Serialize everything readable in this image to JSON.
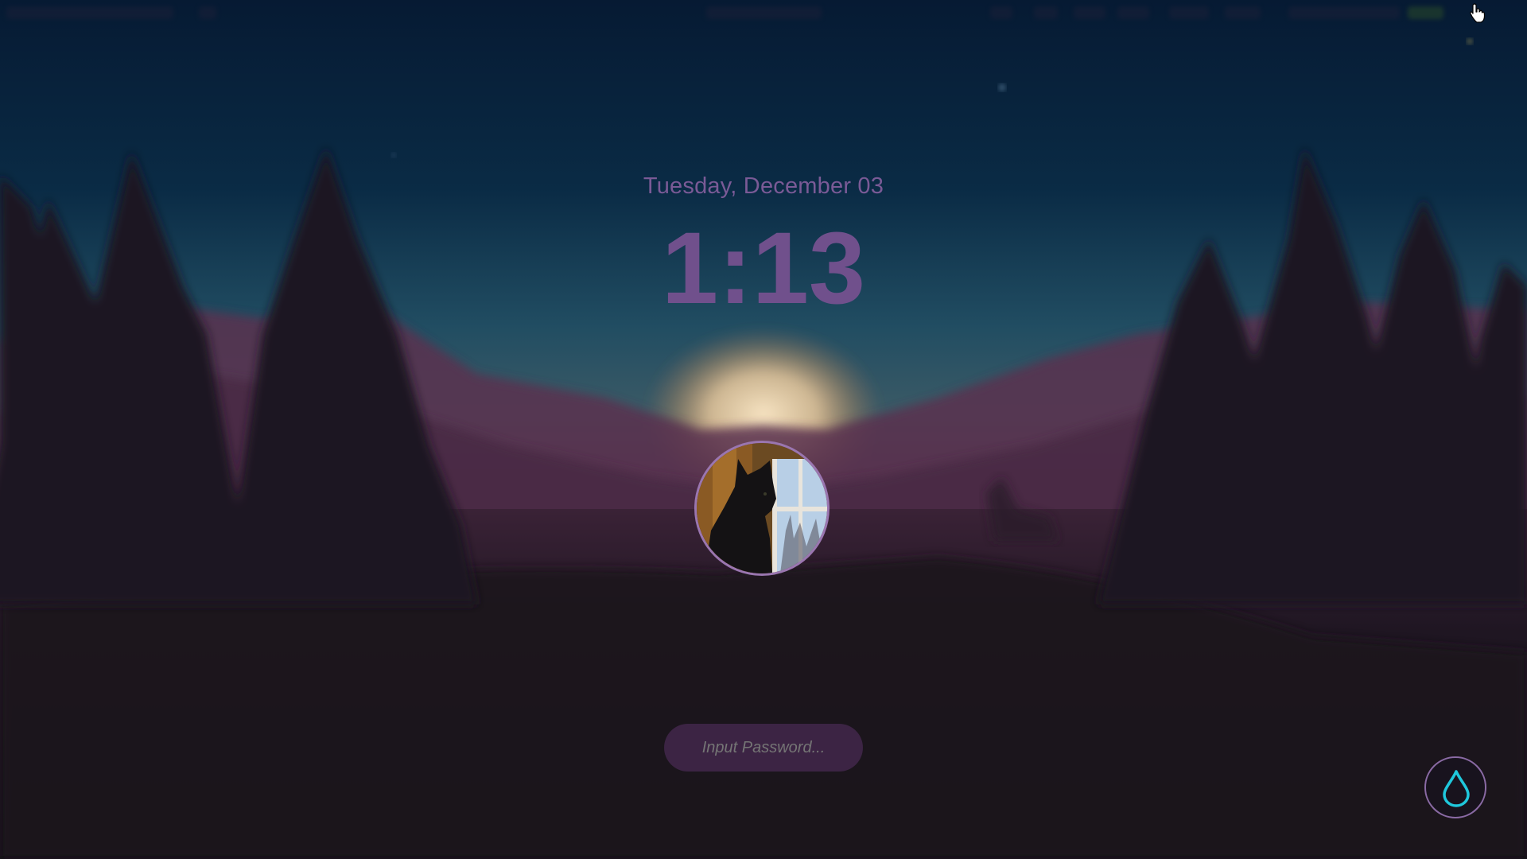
{
  "lockscreen": {
    "date": "Tuesday, December 03",
    "time": "1:13",
    "password_placeholder": "Input Password..."
  },
  "icons": {
    "avatar": "black-cat-avatar",
    "action_button": "water-drop-icon",
    "cursor": "hand-pointer-cursor"
  },
  "colors": {
    "sky_top": "#061a33",
    "sky_horizon": "#2c5f6e",
    "sun_glow": "#f2d8b0",
    "mountains": "#5a3050",
    "trees": "#1e1520",
    "ground": "#17121c",
    "text_accent": "#7a5a96",
    "input_bg": "#3c2444",
    "drop_icon": "#1fc8dc"
  }
}
